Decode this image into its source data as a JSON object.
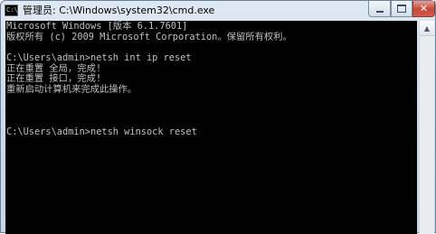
{
  "window": {
    "title": "管理员: C:\\Windows\\system32\\cmd.exe",
    "icon": "cmd-icon",
    "icon_text": "C:\\"
  },
  "controls": {
    "minimize": "minimize-icon",
    "maximize": "maximize-icon",
    "close_label": "✕"
  },
  "console": {
    "lines": [
      "Microsoft Windows [版本 6.1.7601]",
      "版权所有 (c) 2009 Microsoft Corporation。保留所有权利。",
      "",
      "C:\\Users\\admin>netsh int ip reset",
      "正在重置 全局，完成!",
      "正在重置 接口，完成!",
      "重新启动计算机来完成此操作。",
      "",
      "",
      "",
      "C:\\Users\\admin>netsh winsock reset"
    ]
  },
  "scrollbar": {
    "up_arrow": "▲"
  },
  "colors": {
    "console_bg": "#000000",
    "console_text": "#c0c0c0",
    "close_button": "#c7473a"
  }
}
